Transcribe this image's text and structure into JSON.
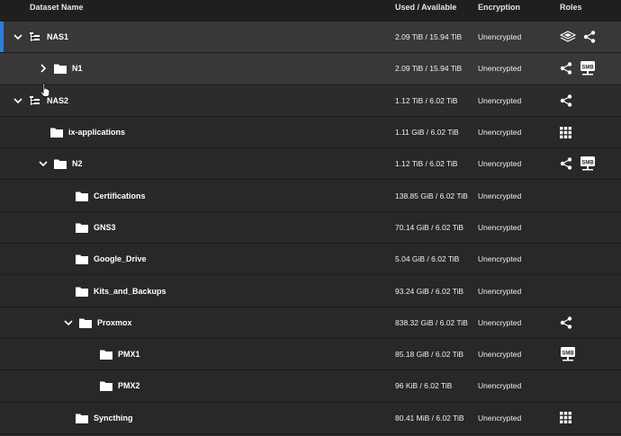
{
  "table": {
    "columns": {
      "name": "Dataset Name",
      "used": "Used / Available",
      "encryption": "Encryption",
      "roles": "Roles"
    },
    "rows": [
      {
        "name": "NAS1",
        "used": "2.09 TiB / 15.94 TiB",
        "encryption": "Unencrypted",
        "roles": [
          "pool-icon",
          "share-icon"
        ],
        "expanded": true,
        "icon": "pool-tree-icon"
      },
      {
        "name": "N1",
        "used": "2.09 TiB / 15.94 TiB",
        "encryption": "Unencrypted",
        "roles": [
          "share-icon",
          "smb-icon"
        ],
        "expanded": false,
        "icon": "folder-icon"
      },
      {
        "name": "NAS2",
        "used": "1.12 TiB / 6.02 TiB",
        "encryption": "Unencrypted",
        "roles": [
          "share-icon"
        ],
        "expanded": true,
        "icon": "pool-tree-icon"
      },
      {
        "name": "ix-applications",
        "used": "1.11 GiB / 6.02 TiB",
        "encryption": "Unencrypted",
        "roles": [
          "apps-grid-icon"
        ],
        "icon": "folder-icon"
      },
      {
        "name": "N2",
        "used": "1.12 TiB / 6.02 TiB",
        "encryption": "Unencrypted",
        "roles": [
          "share-icon",
          "smb-icon"
        ],
        "expanded": true,
        "icon": "folder-icon"
      },
      {
        "name": "Certifications",
        "used": "138.85 GiB / 6.02 TiB",
        "encryption": "Unencrypted",
        "roles": [],
        "icon": "folder-icon"
      },
      {
        "name": "GNS3",
        "used": "70.14 GiB / 6.02 TiB",
        "encryption": "Unencrypted",
        "roles": [],
        "icon": "folder-icon"
      },
      {
        "name": "Google_Drive",
        "used": "5.04 GiB / 6.02 TiB",
        "encryption": "Unencrypted",
        "roles": [],
        "icon": "folder-icon"
      },
      {
        "name": "Kits_and_Backups",
        "used": "93.24 GiB / 6.02 TiB",
        "encryption": "Unencrypted",
        "roles": [],
        "icon": "folder-icon"
      },
      {
        "name": "Proxmox",
        "used": "838.32 GiB / 6.02 TiB",
        "encryption": "Unencrypted",
        "roles": [
          "share-icon"
        ],
        "expanded": true,
        "icon": "folder-icon"
      },
      {
        "name": "PMX1",
        "used": "85.18 GiB / 6.02 TiB",
        "encryption": "Unencrypted",
        "roles": [
          "smb-icon"
        ],
        "icon": "folder-icon"
      },
      {
        "name": "PMX2",
        "used": "96 KiB / 6.02 TiB",
        "encryption": "Unencrypted",
        "roles": [],
        "icon": "folder-icon"
      },
      {
        "name": "Syncthing",
        "used": "80.41 MiB / 6.02 TiB",
        "encryption": "Unencrypted",
        "roles": [
          "apps-grid-icon"
        ],
        "icon": "folder-icon"
      }
    ]
  },
  "smb_label": "SMB",
  "colors": {
    "accent": "#2f7fd6",
    "background": "#282828",
    "header": "#1f1f1f"
  }
}
